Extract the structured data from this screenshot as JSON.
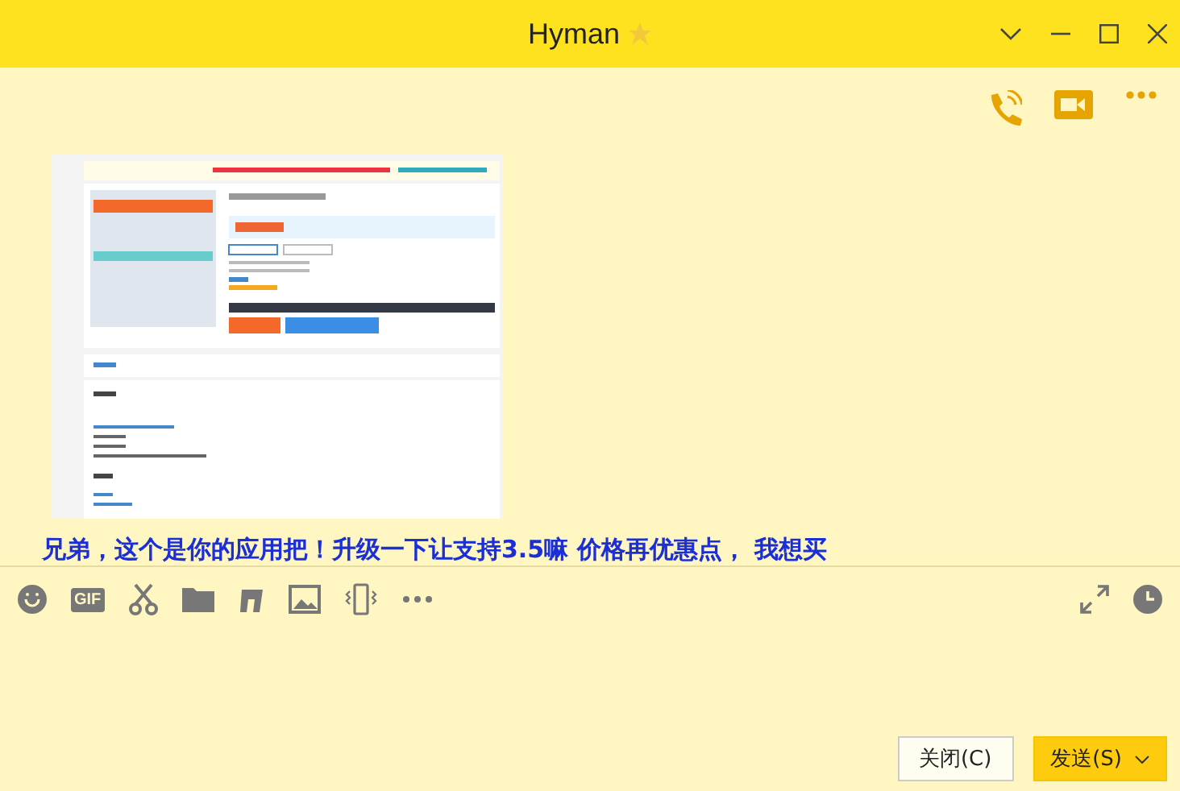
{
  "window": {
    "title": "Hyman"
  },
  "message": {
    "text": "兄弟，这个是你的应用把！升级一下让支持3.5嘛  价格再优惠点， 我想买"
  },
  "toolbar": [
    {
      "kind": "emoji"
    },
    {
      "kind": "gif",
      "label": "GIF"
    },
    {
      "kind": "scissors"
    },
    {
      "kind": "folder"
    },
    {
      "kind": "music"
    },
    {
      "kind": "image"
    },
    {
      "kind": "shake"
    },
    {
      "kind": "more"
    }
  ],
  "buttons": [
    {
      "label": "关闭(C)",
      "kind": "plain"
    },
    {
      "label": "发送(S)",
      "kind": "primary"
    }
  ]
}
